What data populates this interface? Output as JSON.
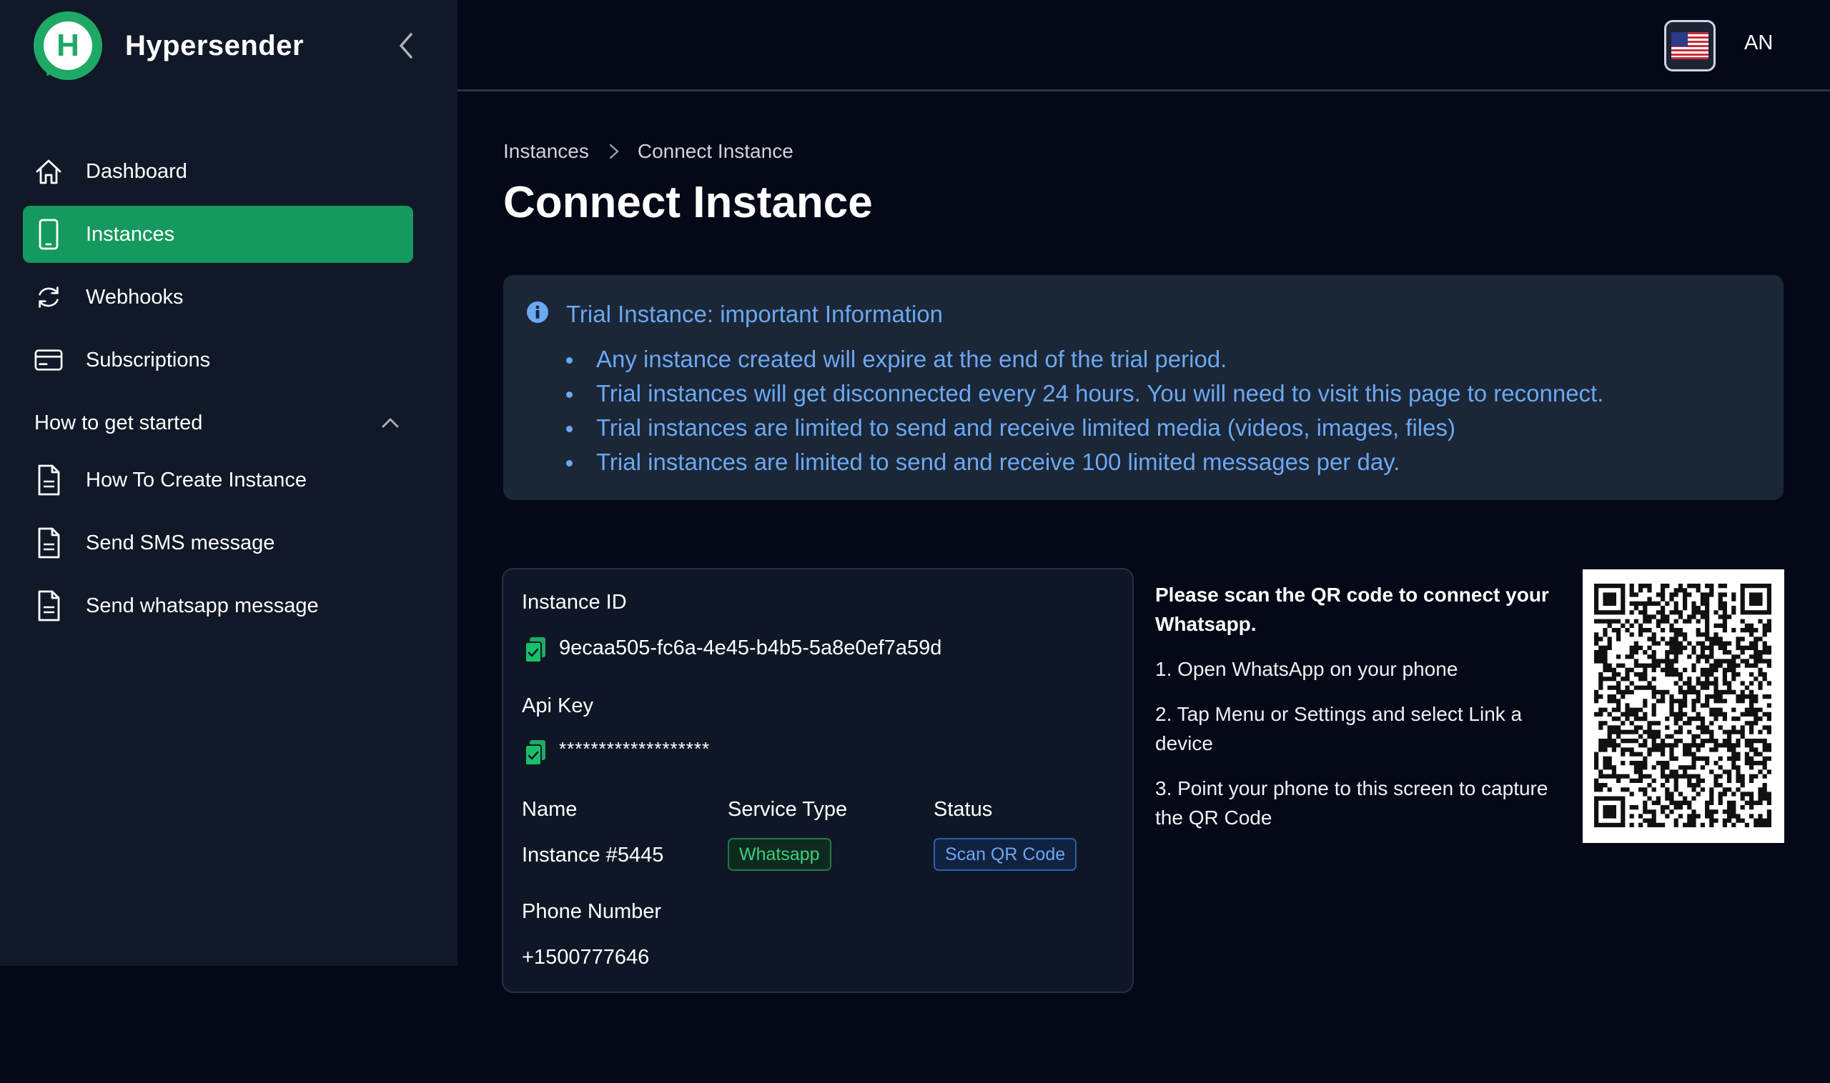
{
  "app": {
    "name": "Hypersender",
    "logo_letter": "H"
  },
  "sidebar": {
    "items": [
      {
        "label": "Dashboard",
        "icon": "home-icon"
      },
      {
        "label": "Instances",
        "icon": "phone-icon",
        "active": true
      },
      {
        "label": "Webhooks",
        "icon": "refresh-icon"
      },
      {
        "label": "Subscriptions",
        "icon": "credit-card-icon"
      }
    ],
    "section": {
      "label": "How to get started",
      "items": [
        {
          "label": "How To Create Instance",
          "icon": "document-icon"
        },
        {
          "label": "Send SMS message",
          "icon": "document-icon"
        },
        {
          "label": "Send whatsapp message",
          "icon": "document-icon"
        }
      ]
    }
  },
  "header": {
    "user_initials": "AN",
    "language_icon": "us-flag-icon"
  },
  "breadcrumb": {
    "parent": "Instances",
    "current": "Connect Instance"
  },
  "page_title": "Connect Instance",
  "alert": {
    "title": "Trial Instance: important Information",
    "items": [
      "Any instance created will expire at the end of the trial period.",
      "Trial instances will get disconnected every 24 hours. You will need to visit this page to reconnect.",
      "Trial instances are limited to send and receive limited media (videos, images, files)",
      "Trial instances are limited to send and receive 100 limited messages per day."
    ],
    "color": "#6ba8f2"
  },
  "instance": {
    "id_label": "Instance ID",
    "id_value": "9ecaa505-fc6a-4e45-b4b5-5a8e0ef7a59d",
    "api_key_label": "Api Key",
    "api_key_value": "*******************",
    "name_label": "Name",
    "name_value": "Instance #5445",
    "service_type_label": "Service Type",
    "service_type_value": "Whatsapp",
    "status_label": "Status",
    "status_value": "Scan QR Code",
    "phone_label": "Phone Number",
    "phone_value": "+1500777646"
  },
  "qr_instructions": {
    "heading": "Please scan the QR code to connect your Whatsapp.",
    "steps": [
      "1. Open WhatsApp on your phone",
      "2. Tap Menu or Settings and select Link a device",
      "3. Point your phone to this screen to capture the QR Code"
    ]
  },
  "colors": {
    "accent": "#14995f",
    "background": "#050816",
    "sidebar": "#111827"
  }
}
